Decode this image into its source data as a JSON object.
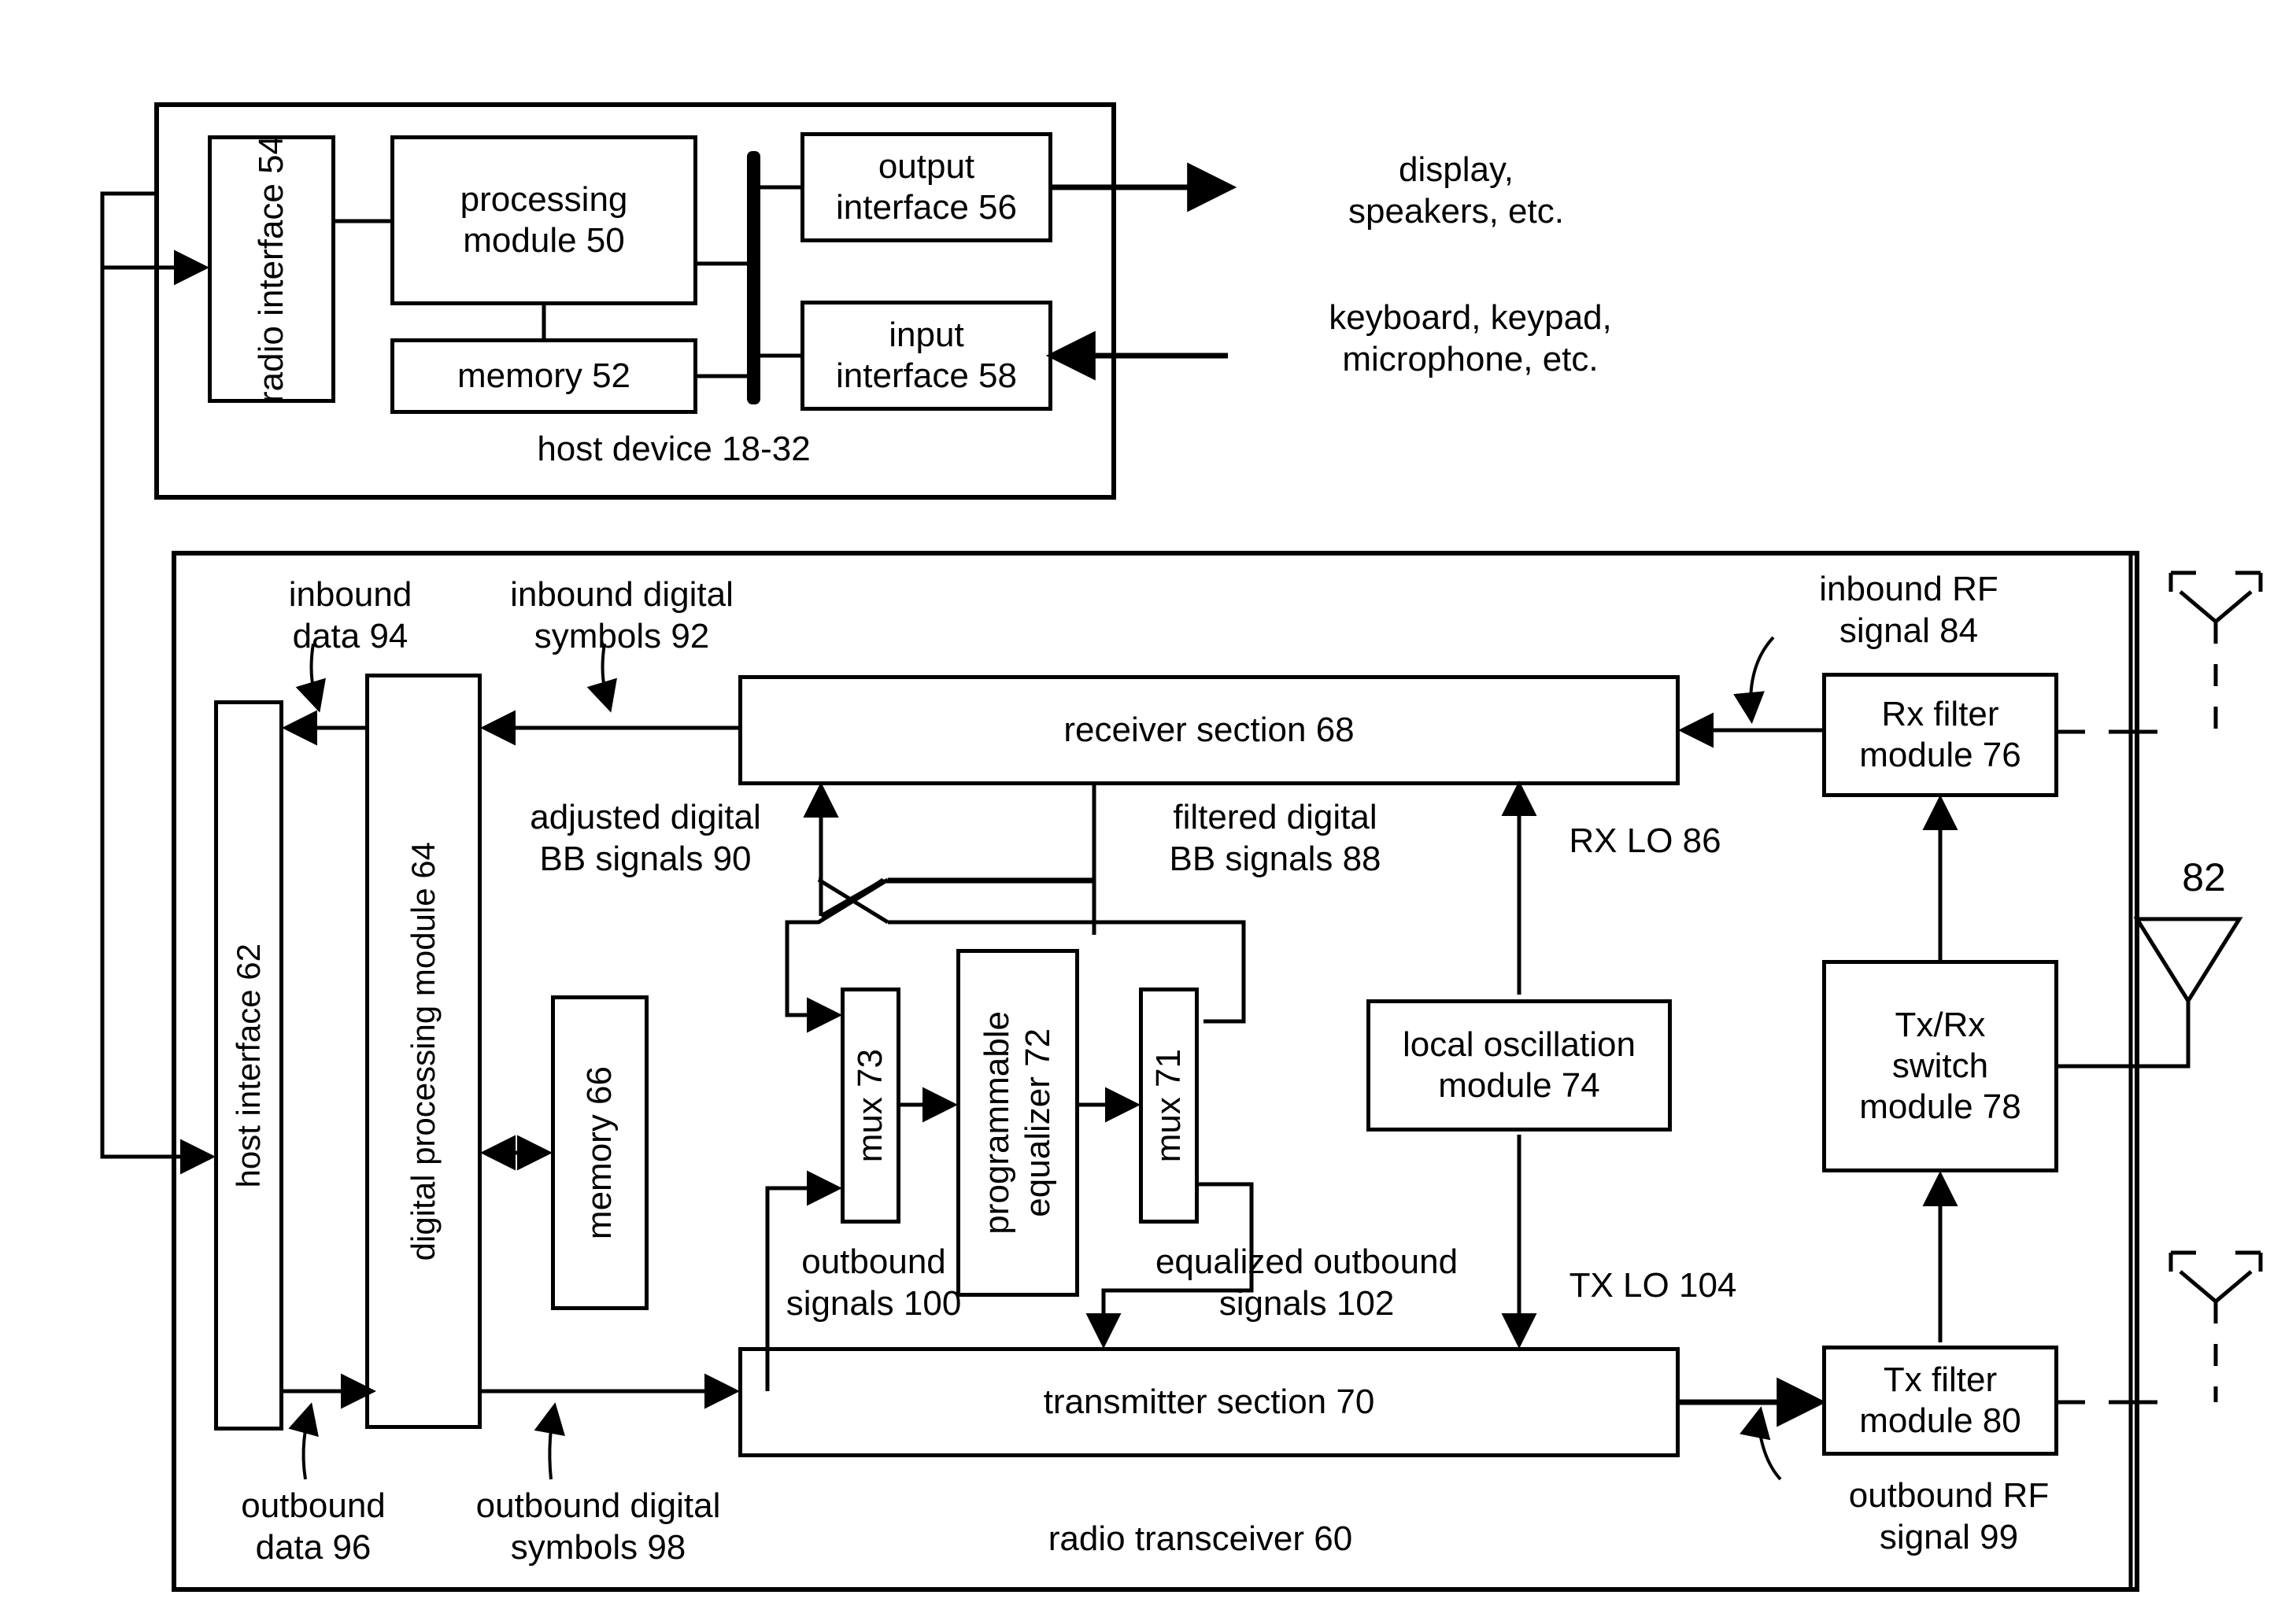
{
  "figure": {
    "host_device": {
      "container_label": "host device 18-32",
      "blocks": [
        {
          "id": "radio-interface",
          "label": "radio\ninterface 54",
          "orientation": "vertical"
        },
        {
          "id": "processing-module",
          "label": "processing\nmodule 50",
          "orientation": "horizontal"
        },
        {
          "id": "memory-52",
          "label": "memory 52",
          "orientation": "horizontal"
        },
        {
          "id": "output-interface",
          "label": "output\ninterface 56",
          "orientation": "horizontal"
        },
        {
          "id": "input-interface",
          "label": "input\ninterface 58",
          "orientation": "horizontal"
        }
      ],
      "external_labels": [
        {
          "id": "output-peripherals",
          "label": "display,\nspeakers, etc."
        },
        {
          "id": "input-peripherals",
          "label": "keyboard, keypad,\nmicrophone, etc."
        }
      ]
    },
    "radio_transceiver": {
      "container_label": "radio transceiver 60",
      "blocks": [
        {
          "id": "host-interface",
          "label": "host interface 62",
          "orientation": "vertical"
        },
        {
          "id": "digital-processing-module",
          "label": "digital processing module 64",
          "orientation": "vertical"
        },
        {
          "id": "memory-66",
          "label": "memory 66",
          "orientation": "vertical"
        },
        {
          "id": "receiver-section",
          "label": "receiver section 68",
          "orientation": "horizontal"
        },
        {
          "id": "transmitter-section",
          "label": "transmitter section 70",
          "orientation": "horizontal"
        },
        {
          "id": "mux-73",
          "label": "mux 73",
          "orientation": "vertical"
        },
        {
          "id": "programmable-equalizer",
          "label": "programmable\nequalizer 72",
          "orientation": "vertical"
        },
        {
          "id": "mux-71",
          "label": "mux 71",
          "orientation": "vertical"
        },
        {
          "id": "local-oscillation-module",
          "label": "local oscillation\nmodule 74",
          "orientation": "horizontal"
        },
        {
          "id": "rx-filter-module",
          "label": "Rx filter\nmodule 76",
          "orientation": "horizontal"
        },
        {
          "id": "tx-rx-switch-module",
          "label": "Tx/Rx\nswitch\nmodule 78",
          "orientation": "horizontal"
        },
        {
          "id": "tx-filter-module",
          "label": "Tx filter\nmodule 80",
          "orientation": "horizontal"
        }
      ],
      "signal_labels": [
        {
          "id": "inbound-data-94",
          "label": "inbound\ndata 94"
        },
        {
          "id": "inbound-digital-symbols-92",
          "label": "inbound digital\nsymbols 92"
        },
        {
          "id": "inbound-rf-signal-84",
          "label": "inbound RF\nsignal 84"
        },
        {
          "id": "adjusted-digital-bb-signals-90",
          "label": "adjusted digital\nBB signals 90"
        },
        {
          "id": "filtered-digital-bb-signals-88",
          "label": "filtered digital\nBB signals 88"
        },
        {
          "id": "rx-lo-86",
          "label": "RX LO 86"
        },
        {
          "id": "tx-lo-104",
          "label": "TX LO 104"
        },
        {
          "id": "outbound-signals-100",
          "label": "outbound\nsignals 100"
        },
        {
          "id": "equalized-outbound-signals-102",
          "label": "equalized outbound\nsignals 102"
        },
        {
          "id": "outbound-data-96",
          "label": "outbound\ndata 96"
        },
        {
          "id": "outbound-digital-symbols-98",
          "label": "outbound digital\nsymbols 98"
        },
        {
          "id": "outbound-rf-signal-99",
          "label": "outbound RF\nsignal 99"
        },
        {
          "id": "antenna-82",
          "label": "82"
        }
      ]
    },
    "colors": {
      "line": "#000000",
      "background": "#ffffff"
    }
  }
}
